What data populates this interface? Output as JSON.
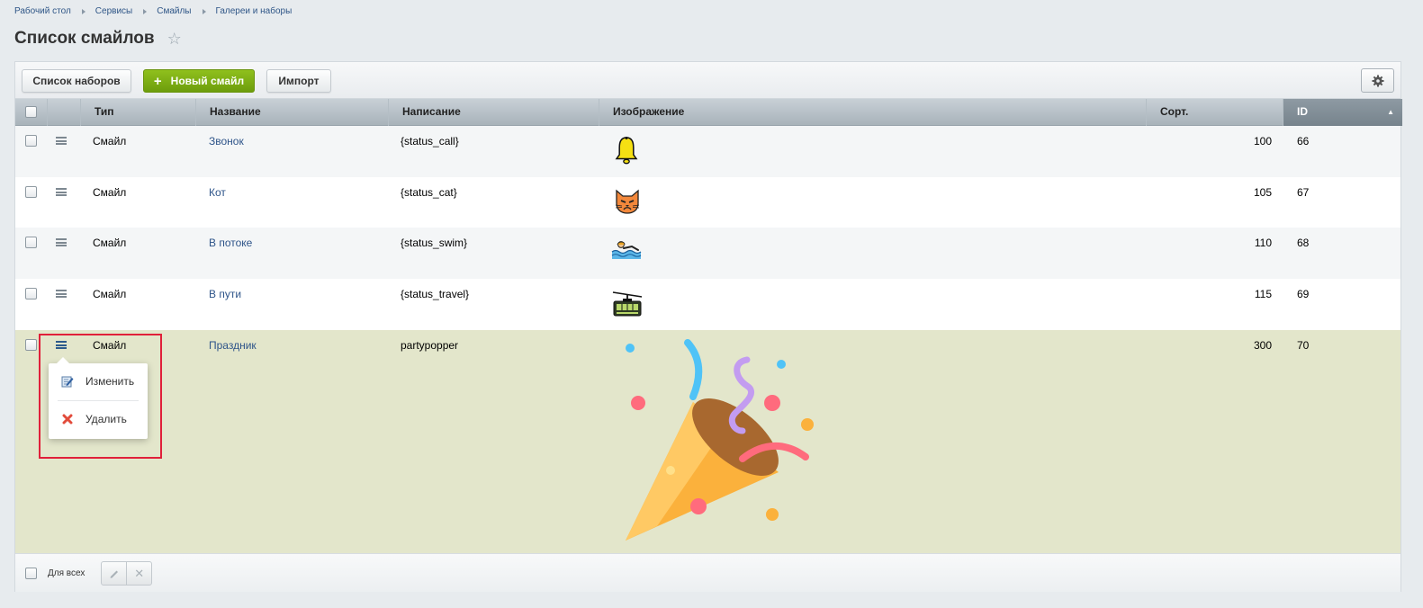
{
  "breadcrumb": [
    "Рабочий стол",
    "Сервисы",
    "Смайлы",
    "Галереи и наборы"
  ],
  "page_title": "Список смайлов",
  "toolbar": {
    "sets_label": "Список наборов",
    "new_label": "Новый смайл",
    "import_label": "Импорт"
  },
  "columns": {
    "type": "Тип",
    "name": "Название",
    "typing": "Написание",
    "image": "Изображение",
    "sort": "Сорт.",
    "id": "ID"
  },
  "rows": [
    {
      "type": "Смайл",
      "name": "Звонок",
      "typing": "{status_call}",
      "image": "bell-icon",
      "sort": "100",
      "id": "66"
    },
    {
      "type": "Смайл",
      "name": "Кот",
      "typing": "{status_cat}",
      "image": "cat-icon",
      "sort": "105",
      "id": "67"
    },
    {
      "type": "Смайл",
      "name": "В потоке",
      "typing": "{status_swim}",
      "image": "swimmer-icon",
      "sort": "110",
      "id": "68"
    },
    {
      "type": "Смайл",
      "name": "В пути",
      "typing": "{status_travel}",
      "image": "cable-car-icon",
      "sort": "115",
      "id": "69"
    },
    {
      "type": "Смайл",
      "name": "Праздник",
      "typing": "partypopper",
      "image": "party-popper-icon",
      "sort": "300",
      "id": "70"
    }
  ],
  "context_menu": {
    "edit_label": "Изменить",
    "delete_label": "Удалить"
  },
  "footer": {
    "for_all_label": "Для всех"
  },
  "colors": {
    "accent_green": "#7aab12",
    "link_blue": "#2e5489",
    "selected_row": "#e3e6cb",
    "highlight_border": "#e0203a"
  }
}
